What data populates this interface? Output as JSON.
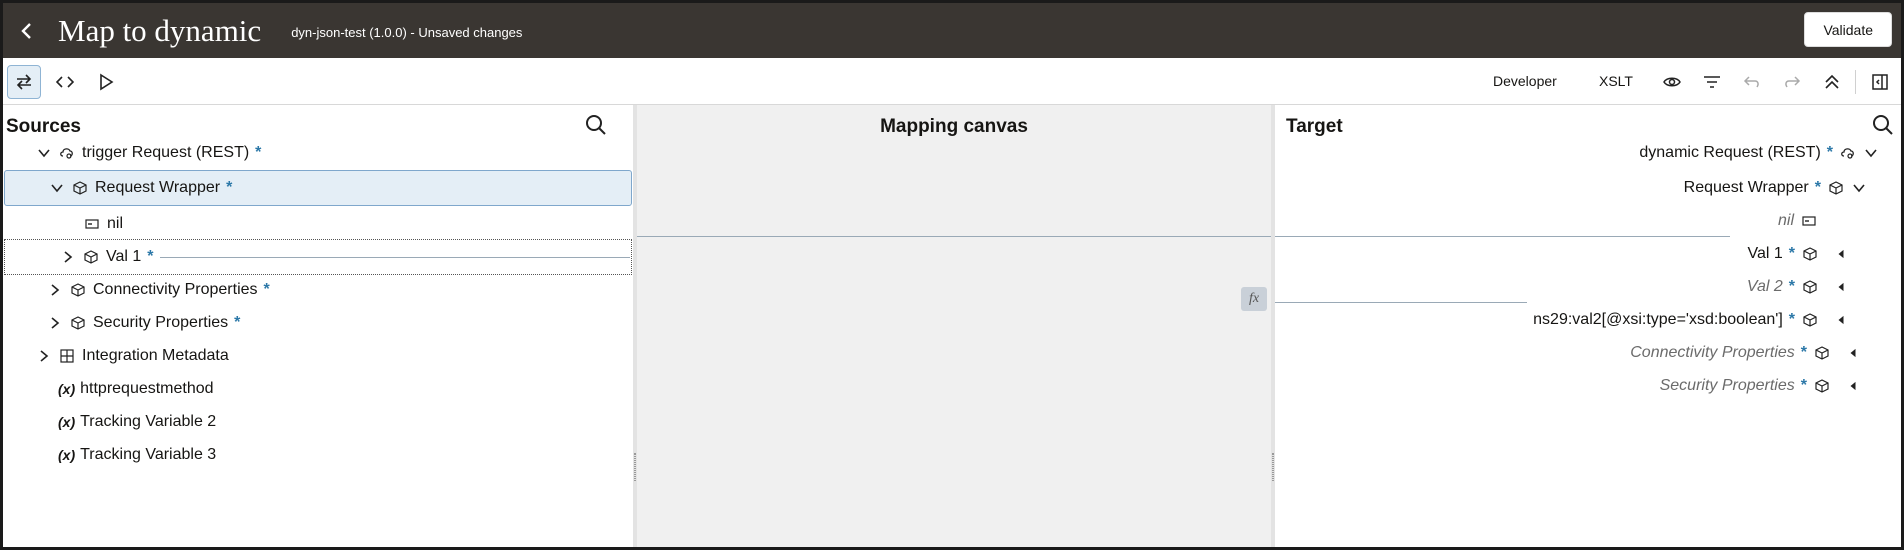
{
  "header": {
    "title": "Map to dynamic",
    "subtitle": "dyn-json-test (1.0.0) - Unsaved changes",
    "validate_label": "Validate"
  },
  "toolbar": {
    "developer_label": "Developer",
    "xslt_label": "XSLT",
    "icons": [
      "swap-icon",
      "code-icon",
      "play-icon",
      "eye-icon",
      "filter-icon",
      "undo-icon",
      "redo-icon",
      "collapse-all-icon",
      "panel-toggle-icon"
    ]
  },
  "sources": {
    "title": "Sources",
    "rows": [
      {
        "label": "trigger Request (REST)",
        "required": "*",
        "icon": "cloud-rest-icon"
      },
      {
        "label": "Request Wrapper",
        "required": "*",
        "icon": "object-icon"
      },
      {
        "label": "nil",
        "required": "",
        "icon": "field-icon"
      },
      {
        "label": "Val 1",
        "required": "*",
        "icon": "object-icon"
      },
      {
        "label": "Connectivity Properties",
        "required": "*",
        "icon": "object-icon"
      },
      {
        "label": "Security Properties",
        "required": "*",
        "icon": "object-icon"
      },
      {
        "label": "Integration Metadata",
        "required": "",
        "icon": "grid-icon"
      },
      {
        "label": "httprequestmethod",
        "prefix": "(x)"
      },
      {
        "label": "Tracking Variable 2",
        "prefix": "(x)"
      },
      {
        "label": "Tracking Variable 3",
        "prefix": "(x)"
      }
    ]
  },
  "canvas": {
    "title": "Mapping canvas",
    "fx_label": "fx"
  },
  "target": {
    "title": "Target",
    "rows": [
      {
        "label": "dynamic Request (REST)",
        "required": "*"
      },
      {
        "label": "Request Wrapper",
        "required": "*"
      },
      {
        "label": "nil",
        "required": ""
      },
      {
        "label": "Val 1",
        "required": "*"
      },
      {
        "label": "Val 2",
        "required": "*"
      },
      {
        "label": "ns29:val2[@xsi:type='xsd:boolean']",
        "required": "*"
      },
      {
        "label": "Connectivity Properties",
        "required": "*"
      },
      {
        "label": "Security Properties",
        "required": "*"
      }
    ]
  },
  "colors": {
    "header_bg": "#3a3632",
    "selected_bg": "#e4eef6",
    "accent": "#2c78a8",
    "canvas_bg": "#f0f0f0"
  }
}
